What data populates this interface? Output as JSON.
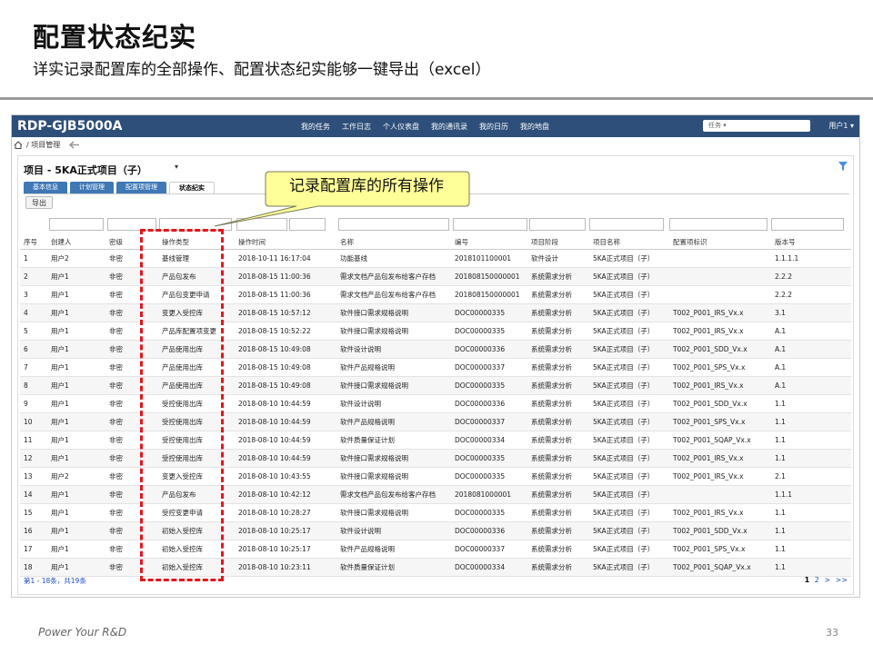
{
  "slide": {
    "title": "配置状态纪实",
    "subtitle": "详实记录配置库的全部操作、配置状态纪实能够一键导出（excel）",
    "footer_brand": "Power Your R&D",
    "page_number": "33"
  },
  "app": {
    "brand": "RDP-GJB5000A",
    "nav": [
      "我的任务",
      "工作日志",
      "个人仪表盘",
      "我的通讯录",
      "我的日历",
      "我的地盘"
    ],
    "task_select": "任务 ▾",
    "user": "用户1 ▾",
    "breadcrumb": "/ 项目管理",
    "project_title": "项目 - 5KA正式项目（子）",
    "tabs": [
      "基本信息",
      "计划管理",
      "配置项管理",
      "状态纪实"
    ],
    "active_tab": "状态纪实",
    "export_label": "导出",
    "callout": "记录配置库的所有操作",
    "columns": [
      "序号",
      "创建人",
      "密级",
      "操作类型",
      "操作时间",
      "名称",
      "编号",
      "项目阶段",
      "项目名称",
      "配置项标识",
      "版本号"
    ],
    "rows": [
      [
        "1",
        "用户2",
        "非密",
        "基线管理",
        "2018-10-11 16:17:04",
        "功能基线",
        "2018101100001",
        "软件设计",
        "5KA正式项目（子）",
        "",
        "1.1.1.1"
      ],
      [
        "2",
        "用户1",
        "非密",
        "产品包发布",
        "2018-08-15 11:00:36",
        "需求文档产品包发布给客户存档",
        "201808150000001",
        "系统需求分析",
        "5KA正式项目（子）",
        "",
        "2.2.2"
      ],
      [
        "3",
        "用户1",
        "非密",
        "产品包变更申请",
        "2018-08-15 11:00:36",
        "需求文档产品包发布给客户存档",
        "201808150000001",
        "系统需求分析",
        "5KA正式项目（子）",
        "",
        "2.2.2"
      ],
      [
        "4",
        "用户1",
        "非密",
        "变更入受控库",
        "2018-08-15 10:57:12",
        "软件接口需求规格说明",
        "DOC00000335",
        "系统需求分析",
        "5KA正式项目（子）",
        "T002_P001_IRS_Vx.x",
        "3.1"
      ],
      [
        "5",
        "用户1",
        "非密",
        "产品库配置项变更",
        "2018-08-15 10:52:22",
        "软件接口需求规格说明",
        "DOC00000335",
        "系统需求分析",
        "5KA正式项目（子）",
        "T002_P001_IRS_Vx.x",
        "A.1"
      ],
      [
        "6",
        "用户1",
        "非密",
        "产品使用出库",
        "2018-08-15 10:49:08",
        "软件设计说明",
        "DOC00000336",
        "系统需求分析",
        "5KA正式项目（子）",
        "T002_P001_SDD_Vx.x",
        "A.1"
      ],
      [
        "7",
        "用户1",
        "非密",
        "产品使用出库",
        "2018-08-15 10:49:08",
        "软件产品规格说明",
        "DOC00000337",
        "系统需求分析",
        "5KA正式项目（子）",
        "T002_P001_SPS_Vx.x",
        "A.1"
      ],
      [
        "8",
        "用户1",
        "非密",
        "产品使用出库",
        "2018-08-15 10:49:08",
        "软件接口需求规格说明",
        "DOC00000335",
        "系统需求分析",
        "5KA正式项目（子）",
        "T002_P001_IRS_Vx.x",
        "A.1"
      ],
      [
        "9",
        "用户1",
        "非密",
        "受控使用出库",
        "2018-08-10 10:44:59",
        "软件设计说明",
        "DOC00000336",
        "系统需求分析",
        "5KA正式项目（子）",
        "T002_P001_SDD_Vx.x",
        "1.1"
      ],
      [
        "10",
        "用户1",
        "非密",
        "受控使用出库",
        "2018-08-10 10:44:59",
        "软件产品规格说明",
        "DOC00000337",
        "系统需求分析",
        "5KA正式项目（子）",
        "T002_P001_SPS_Vx.x",
        "1.1"
      ],
      [
        "11",
        "用户1",
        "非密",
        "受控使用出库",
        "2018-08-10 10:44:59",
        "软件质量保证计划",
        "DOC00000334",
        "系统需求分析",
        "5KA正式项目（子）",
        "T002_P001_SQAP_Vx.x",
        "1.1"
      ],
      [
        "12",
        "用户1",
        "非密",
        "受控使用出库",
        "2018-08-10 10:44:59",
        "软件接口需求规格说明",
        "DOC00000335",
        "系统需求分析",
        "5KA正式项目（子）",
        "T002_P001_IRS_Vx.x",
        "1.1"
      ],
      [
        "13",
        "用户2",
        "非密",
        "变更入受控库",
        "2018-08-10 10:43:55",
        "软件接口需求规格说明",
        "DOC00000335",
        "系统需求分析",
        "5KA正式项目（子）",
        "T002_P001_IRS_Vx.x",
        "2.1"
      ],
      [
        "14",
        "用户1",
        "非密",
        "产品包发布",
        "2018-08-10 10:42:12",
        "需求文档产品包发布给客户存档",
        "2018081000001",
        "系统需求分析",
        "5KA正式项目（子）",
        "",
        "1.1.1"
      ],
      [
        "15",
        "用户1",
        "非密",
        "受控变更申请",
        "2018-08-10 10:28:27",
        "软件接口需求规格说明",
        "DOC00000335",
        "系统需求分析",
        "5KA正式项目（子）",
        "T002_P001_IRS_Vx.x",
        "1.1"
      ],
      [
        "16",
        "用户1",
        "非密",
        "初始入受控库",
        "2018-08-10 10:25:17",
        "软件设计说明",
        "DOC00000336",
        "系统需求分析",
        "5KA正式项目（子）",
        "T002_P001_SDD_Vx.x",
        "1.1"
      ],
      [
        "17",
        "用户1",
        "非密",
        "初始入受控库",
        "2018-08-10 10:25:17",
        "软件产品规格说明",
        "DOC00000337",
        "系统需求分析",
        "5KA正式项目（子）",
        "T002_P001_SPS_Vx.x",
        "1.1"
      ],
      [
        "18",
        "用户1",
        "非密",
        "初始入受控库",
        "2018-08-10 10:23:11",
        "软件质量保证计划",
        "DOC00000334",
        "系统需求分析",
        "5KA正式项目（子）",
        "T002_P001_SQAP_Vx.x",
        "1.1"
      ]
    ],
    "pager_info": "第1 - 18条，共19条",
    "pager_current": "1",
    "pager_links": [
      "2",
      ">",
      ">>"
    ]
  },
  "colors": {
    "topbar": "#2d4f7a",
    "tab": "#3f78b5",
    "link": "#1f4ec4",
    "highlight": "#e3161b",
    "callout": "#ffff99"
  }
}
